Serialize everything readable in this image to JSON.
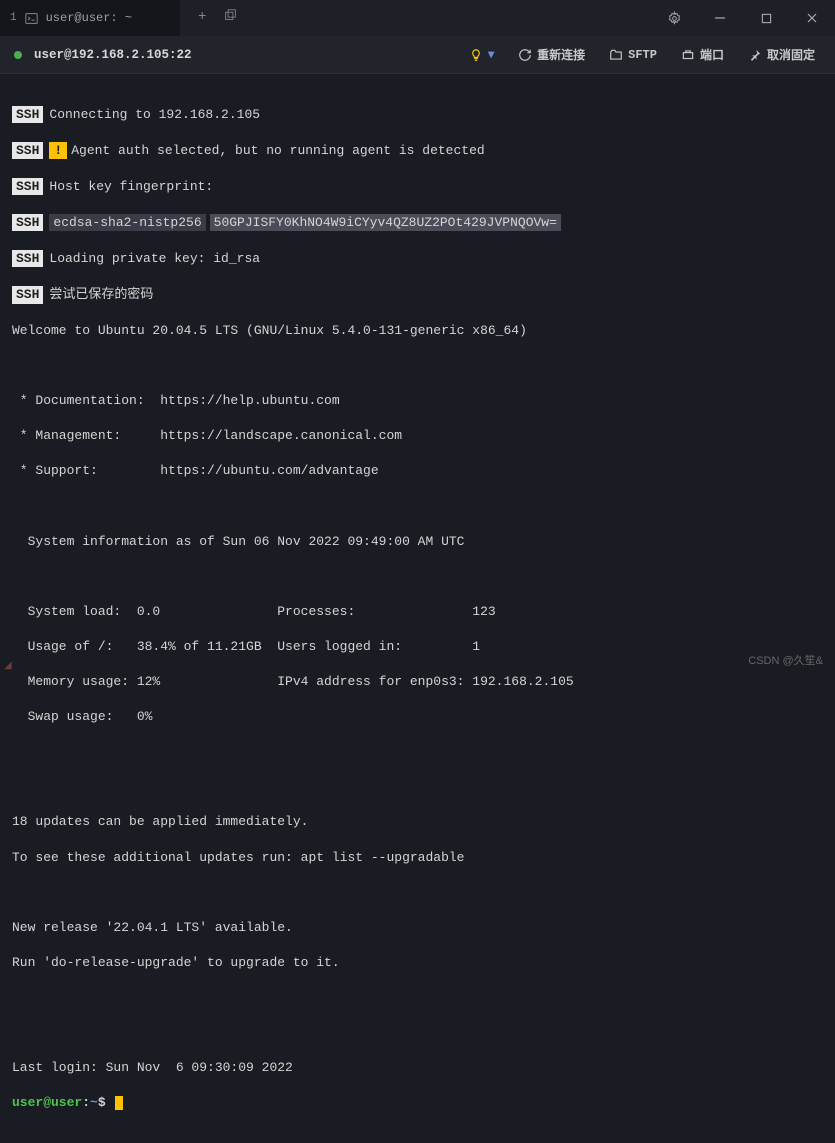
{
  "tab": {
    "num": "1",
    "title": "user@user: ~"
  },
  "toolbar": {
    "connection": "user@192.168.2.105:22",
    "reconnect": "重新连接",
    "sftp": "SFTP",
    "port": "端口",
    "unpin": "取消固定"
  },
  "ssh": {
    "line1": "Connecting to 192.168.2.105",
    "line2": "Agent auth selected, but no running agent is detected",
    "line3": "Host key fingerprint:",
    "line4a": "ecdsa-sha2-nistp256",
    "line4b": "50GPJISFY0KhNO4W9iCYyv4QZ8UZ2POt429JVPNQOVw=",
    "line5": "Loading private key: id_rsa",
    "line6": "尝试已保存的密码"
  },
  "motd": {
    "welcome": "Welcome to Ubuntu 20.04.5 LTS (GNU/Linux 5.4.0-131-generic x86_64)",
    "doc": " * Documentation:  https://help.ubuntu.com",
    "mgmt": " * Management:     https://landscape.canonical.com",
    "sup": " * Support:        https://ubuntu.com/advantage",
    "sysinfo_hdr": "  System information as of Sun 06 Nov 2022 09:49:00 AM UTC",
    "r1": "  System load:  0.0               Processes:               123",
    "r2": "  Usage of /:   38.4% of 11.21GB  Users logged in:         1",
    "r3": "  Memory usage: 12%               IPv4 address for enp0s3: 192.168.2.105",
    "r4": "  Swap usage:   0%",
    "upd1": "18 updates can be applied immediately.",
    "upd2": "To see these additional updates run: apt list --upgradable",
    "rel1": "New release '22.04.1 LTS' available.",
    "rel2": "Run 'do-release-upgrade' to upgrade to it.",
    "last": "Last login: Sun Nov  6 09:30:09 2022"
  },
  "prompt": {
    "user": "user@user",
    "colon": ":",
    "path": "~",
    "sym": "$"
  },
  "watermark": "CSDN @久笙&"
}
